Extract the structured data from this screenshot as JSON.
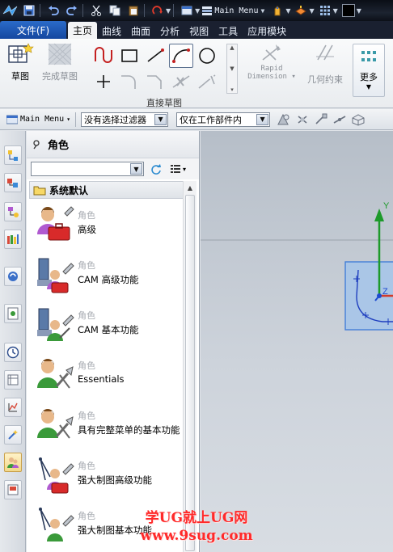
{
  "quick_access": {
    "main_menu_label": "Main Menu"
  },
  "tabs": {
    "file_label": "文件(F)",
    "items": [
      "主页",
      "曲线",
      "曲面",
      "分析",
      "视图",
      "工具",
      "应用模块"
    ],
    "active_index": 0
  },
  "ribbon": {
    "sketch_label": "草图",
    "finish_sketch_label": "完成草图",
    "direct_sketch_group_label": "直接草图",
    "rapid_dimension_label_line1": "Rapid",
    "rapid_dimension_label_line2": "Dimension",
    "geometric_constraints_label": "几何约束",
    "more_label": "更多"
  },
  "filter_bar": {
    "main_menu_label": "Main Menu",
    "selection_filter_value": "没有选择过滤器",
    "scope_value": "仅在工作部件内"
  },
  "roles_panel": {
    "title": "角色",
    "search_value": "",
    "group_title": "系统默认",
    "items": [
      {
        "category": "角色",
        "name": "高级"
      },
      {
        "category": "角色",
        "name": "CAM 高级功能"
      },
      {
        "category": "角色",
        "name": "CAM 基本功能"
      },
      {
        "category": "角色",
        "name": "Essentials"
      },
      {
        "category": "角色",
        "name": "具有完整菜单的基本功能"
      },
      {
        "category": "角色",
        "name": "强大制图高级功能"
      },
      {
        "category": "角色",
        "name": "强大制图基本功能"
      }
    ]
  },
  "graphics": {
    "axis_y_label": "Y",
    "axis_z_label": "Z"
  },
  "watermark": {
    "line1": "学UG就上UG网",
    "line2": "www.9sug.com"
  },
  "colors": {
    "file_tab": "#1547a0",
    "title_bar": "#0c1018",
    "axis_y": "#1d9a2a",
    "axis_x": "#d23a2a",
    "axis_z": "#1d4ad0",
    "watermark": "#ff2a2a"
  }
}
